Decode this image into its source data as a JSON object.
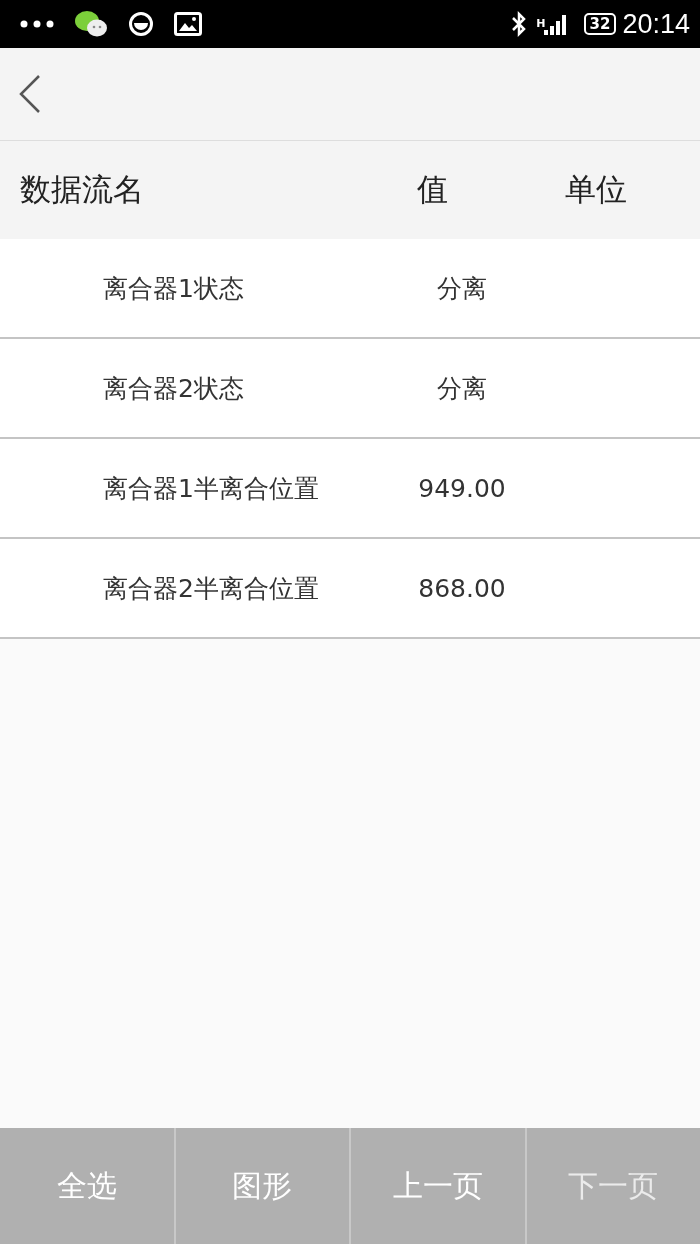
{
  "status_bar": {
    "network": "H",
    "battery": "32",
    "time": "20:14"
  },
  "table": {
    "columns": [
      "数据流名",
      "值",
      "单位"
    ],
    "rows": [
      {
        "name": "离合器1状态",
        "value": "分离"
      },
      {
        "name": "离合器2状态",
        "value": "分离"
      },
      {
        "name": "离合器1半离合位置",
        "value": "949.00"
      },
      {
        "name": "离合器2半离合位置",
        "value": "868.00"
      }
    ]
  },
  "buttons": [
    {
      "label": "全选",
      "disabled": false
    },
    {
      "label": "图形",
      "disabled": false
    },
    {
      "label": "上一页",
      "disabled": false
    },
    {
      "label": "下一页",
      "disabled": true
    }
  ]
}
